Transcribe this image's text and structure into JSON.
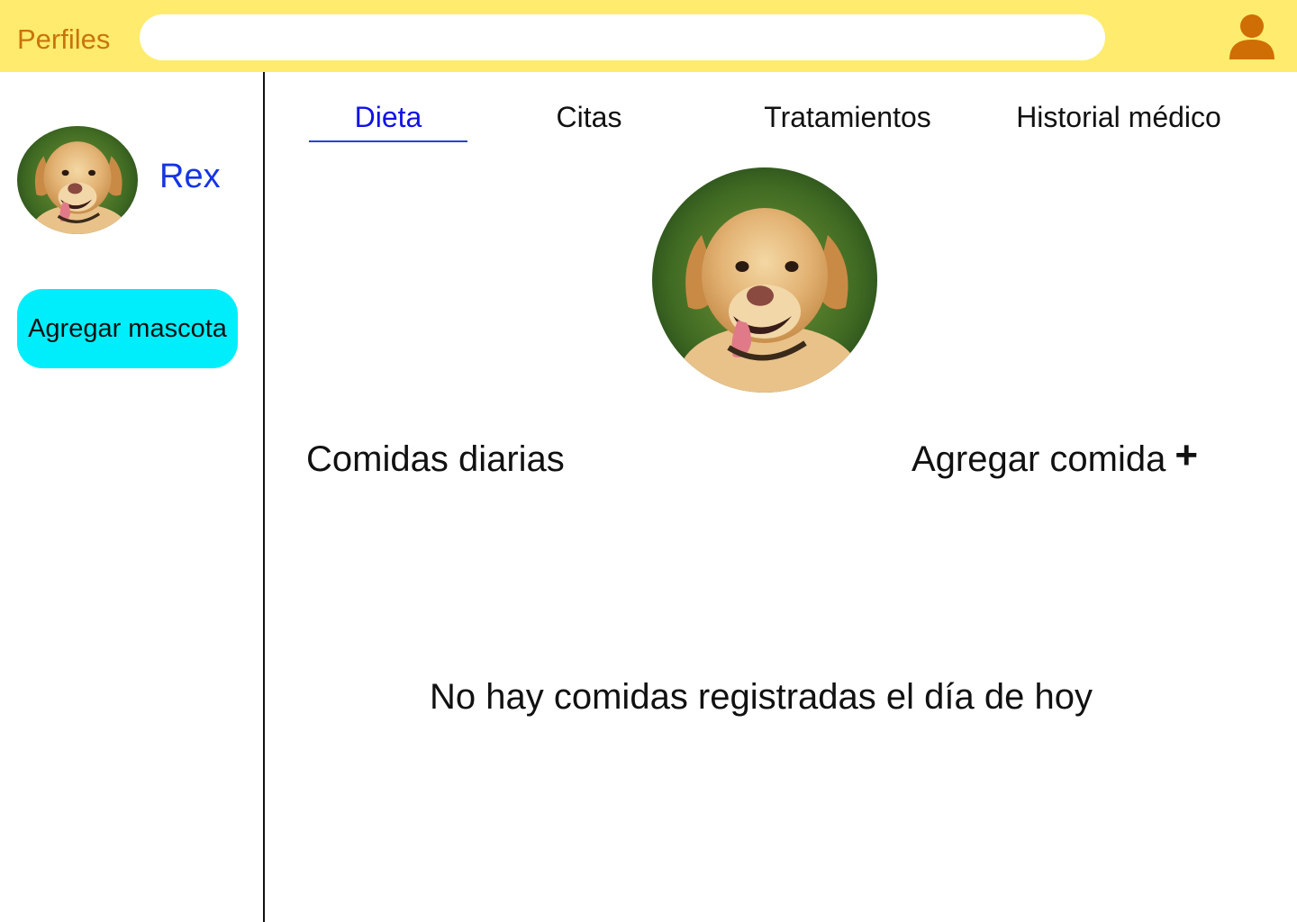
{
  "header": {
    "title": "Perfiles",
    "search_placeholder": "",
    "user_icon": "user-icon"
  },
  "sidebar": {
    "pets": [
      {
        "name": "Rex",
        "avatar": "dog-photo"
      }
    ],
    "add_pet_label": "Agregar mascota"
  },
  "tabs": [
    {
      "label": "Dieta",
      "active": true
    },
    {
      "label": "Citas",
      "active": false
    },
    {
      "label": "Tratamientos",
      "active": false
    },
    {
      "label": "Historial médico",
      "active": false
    }
  ],
  "main": {
    "section_title": "Comidas diarias",
    "add_food_label": "Agregar comida",
    "add_food_icon": "plus-icon",
    "empty_message": "No hay comidas registradas el día de hoy"
  },
  "colors": {
    "header_bg": "#ffeb6e",
    "title": "#c9740a",
    "pet_name": "#1434e6",
    "add_pet_bg": "#00eefc",
    "active_tab": "#1111e6"
  }
}
